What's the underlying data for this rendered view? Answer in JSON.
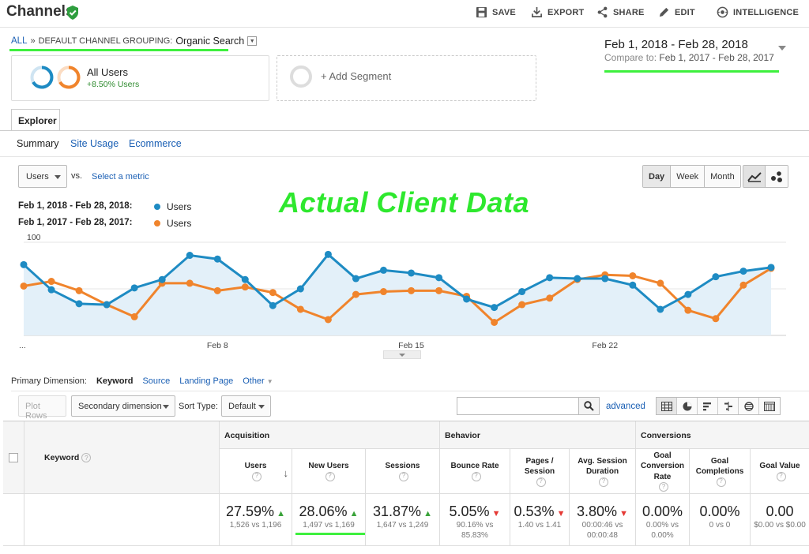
{
  "header": {
    "title": "Channels",
    "actions": [
      "SAVE",
      "EXPORT",
      "SHARE",
      "EDIT",
      "INTELLIGENCE"
    ]
  },
  "breadcrumb": {
    "all": "ALL",
    "separator": "»",
    "label": "DEFAULT CHANNEL GROUPING:",
    "value": "Organic Search"
  },
  "segments": {
    "active_name": "All Users",
    "active_change": "+8.50% Users",
    "add_label": "+ Add Segment"
  },
  "date_range": {
    "main": "Feb 1, 2018 - Feb 28, 2018",
    "compare_label": "Compare to:",
    "compare_value": "Feb 1, 2017 - Feb 28, 2017"
  },
  "tabs": {
    "explorer": "Explorer",
    "subtabs": [
      "Summary",
      "Site Usage",
      "Ecommerce"
    ]
  },
  "chart_controls": {
    "metric": "Users",
    "vs": "vs.",
    "select_metric": "Select a metric",
    "granularity": [
      "Day",
      "Week",
      "Month"
    ]
  },
  "legend": [
    {
      "range": "Feb 1, 2018 - Feb 28, 2018:",
      "name": "Users",
      "color": "#1e8bc3"
    },
    {
      "range": "Feb 1, 2017 - Feb 28, 2017:",
      "name": "Users",
      "color": "#f0842c"
    }
  ],
  "watermark": "Actual Client Data",
  "chart_data": {
    "type": "line",
    "x": [
      1,
      2,
      3,
      4,
      5,
      6,
      7,
      8,
      9,
      10,
      11,
      12,
      13,
      14,
      15,
      16,
      17,
      18,
      19,
      20,
      21,
      22,
      23,
      24,
      25,
      26,
      27,
      28
    ],
    "x_tick_labels": [
      "...",
      "Feb 8",
      "Feb 15",
      "Feb 22"
    ],
    "ylim": [
      0,
      100
    ],
    "y_ticks": [
      100,
      50
    ],
    "series": [
      {
        "name": "Users",
        "color": "#1e8bc3",
        "fill": true,
        "values": [
          76,
          49,
          34,
          33,
          51,
          60,
          86,
          82,
          60,
          32,
          50,
          87,
          61,
          70,
          67,
          62,
          39,
          30,
          47,
          62,
          61,
          61,
          54,
          28,
          44,
          63,
          69,
          73
        ]
      },
      {
        "name": "Users",
        "color": "#f0842c",
        "fill": false,
        "values": [
          53,
          58,
          48,
          33,
          20,
          56,
          56,
          48,
          52,
          46,
          28,
          17,
          44,
          47,
          48,
          48,
          42,
          14,
          33,
          40,
          60,
          65,
          64,
          56,
          27,
          18,
          54,
          72
        ]
      }
    ]
  },
  "table_controls": {
    "primary_dimension_label": "Primary Dimension:",
    "dimensions": [
      "Keyword",
      "Source",
      "Landing Page",
      "Other"
    ],
    "plot_rows": "Plot Rows",
    "secondary_dimension": "Secondary dimension",
    "sort_type_label": "Sort Type:",
    "sort_type": "Default",
    "search_placeholder": "",
    "advanced": "advanced"
  },
  "table": {
    "dimension_header": "Keyword",
    "groups": [
      "Acquisition",
      "Behavior",
      "Conversions"
    ],
    "columns": [
      {
        "label": "Users",
        "value": "27.59%",
        "trend": "up",
        "sub": "1,526 vs 1,196"
      },
      {
        "label": "New Users",
        "value": "28.06%",
        "trend": "up",
        "sub": "1,497 vs 1,169"
      },
      {
        "label": "Sessions",
        "value": "31.87%",
        "trend": "up",
        "sub": "1,647 vs 1,249"
      },
      {
        "label": "Bounce Rate",
        "value": "5.05%",
        "trend": "down",
        "sub": "90.16% vs 85.83%"
      },
      {
        "label": "Pages / Session",
        "value": "0.53%",
        "trend": "down",
        "sub": "1.40 vs 1.41"
      },
      {
        "label": "Avg. Session Duration",
        "value": "3.80%",
        "trend": "down",
        "sub": "00:00:46 vs 00:00:48"
      },
      {
        "label": "Goal Conversion Rate",
        "value": "0.00%",
        "trend": "",
        "sub": "0.00% vs 0.00%"
      },
      {
        "label": "Goal Completions",
        "value": "0.00%",
        "trend": "",
        "sub": "0 vs 0"
      },
      {
        "label": "Goal Value",
        "value": "0.00",
        "trend": "",
        "sub": "$0.00 vs $0.00"
      }
    ]
  }
}
